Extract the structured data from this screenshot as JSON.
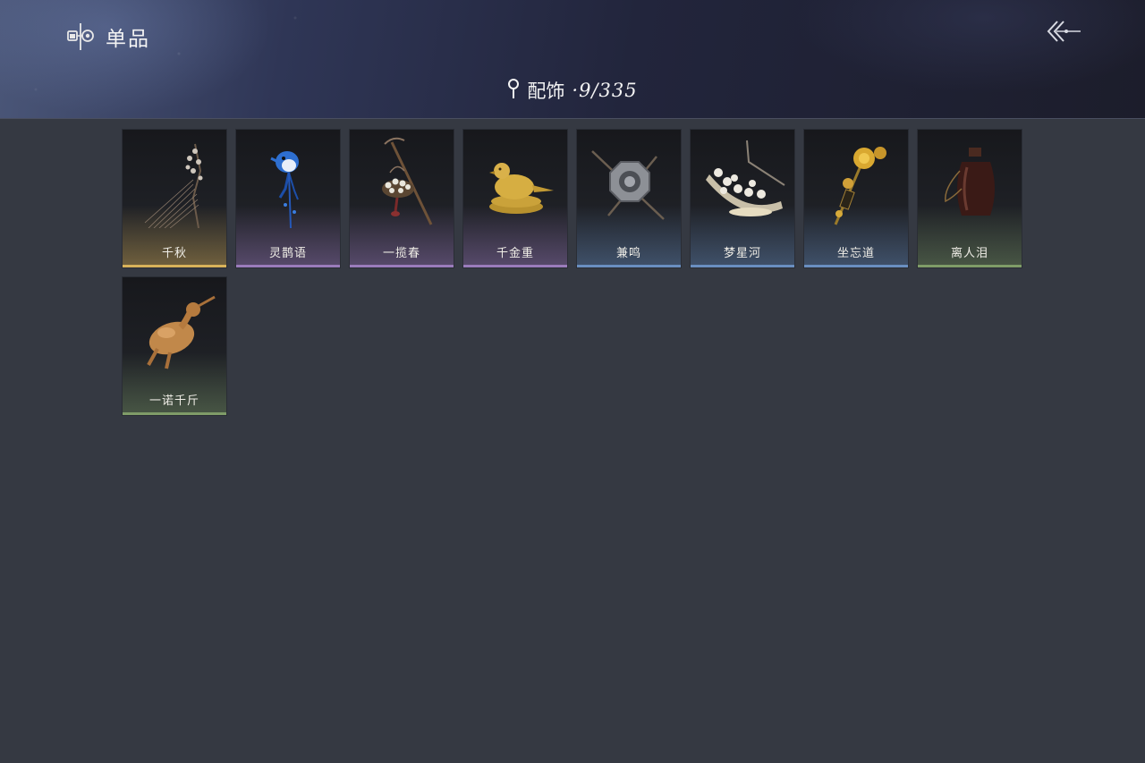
{
  "header": {
    "title": "单品",
    "title_icon": "accessory-collection-icon",
    "back_icon": "back-arrow-icon"
  },
  "category": {
    "icon": "location-pin-icon",
    "label": "配饰",
    "count": "·9/335"
  },
  "items": [
    {
      "name": "千秋",
      "rarity_color": "#c9a24a",
      "icon": "hairpin-with-plum-blossoms-icon"
    },
    {
      "name": "灵鹊语",
      "rarity_color": "#8f6fb0",
      "icon": "blue-magpie-hairpin-icon"
    },
    {
      "name": "一揽春",
      "rarity_color": "#8f6fb0",
      "icon": "flower-basket-on-pole-icon"
    },
    {
      "name": "千金重",
      "rarity_color": "#8f6fb0",
      "icon": "golden-bird-ornament-icon"
    },
    {
      "name": "兼鸣",
      "rarity_color": "#5a7fae",
      "icon": "octagonal-drum-icon"
    },
    {
      "name": "梦星河",
      "rarity_color": "#5a7fae",
      "icon": "flower-boat-icon"
    },
    {
      "name": "坐忘道",
      "rarity_color": "#5a7fae",
      "icon": "golden-flower-hairpin-icon"
    },
    {
      "name": "离人泪",
      "rarity_color": "#6d8a5a",
      "icon": "dark-wine-jar-icon"
    },
    {
      "name": "一诺千斤",
      "rarity_color": "#6d8a5a",
      "icon": "roasted-bird-icon"
    }
  ]
}
